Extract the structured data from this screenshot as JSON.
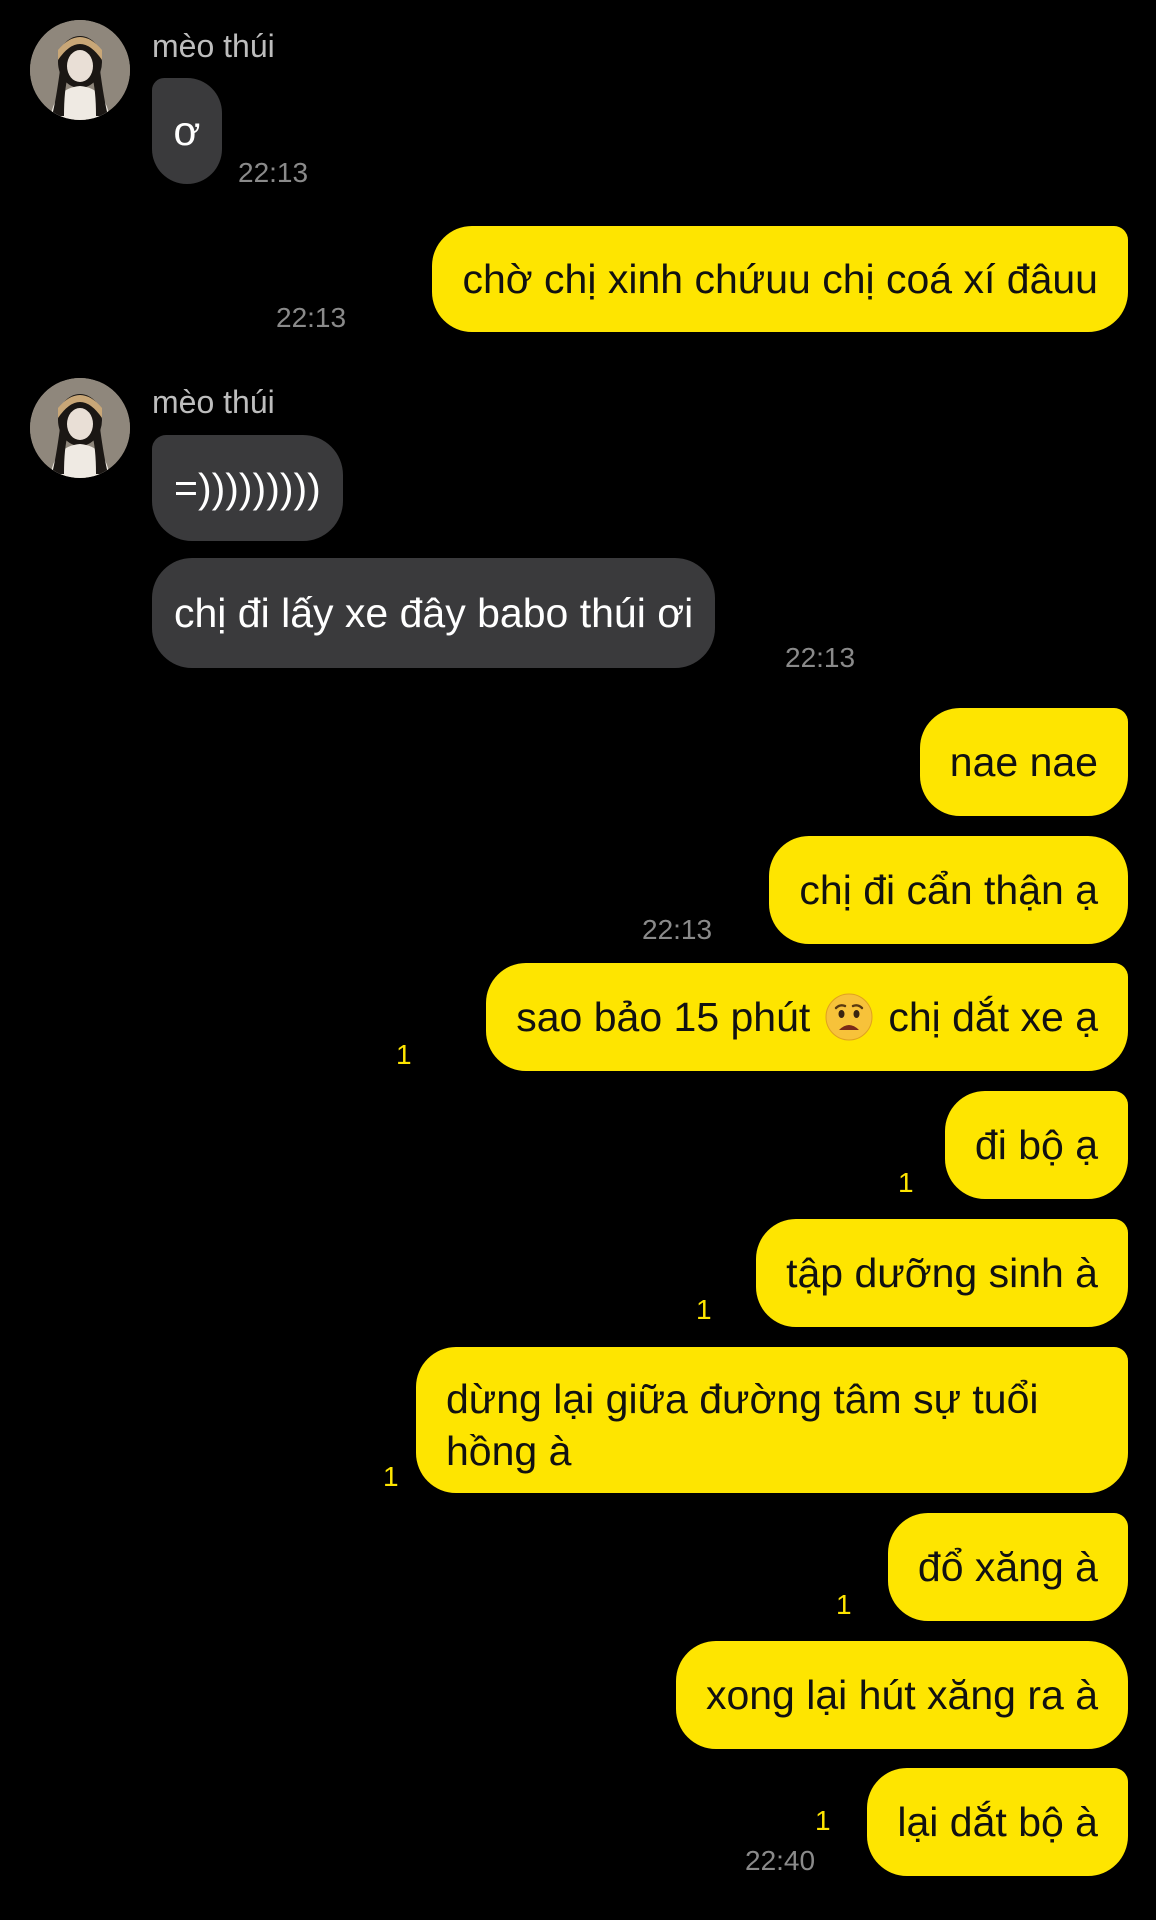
{
  "contact": {
    "name": "mèo thúi"
  },
  "messages": {
    "m1": {
      "text": "ơ",
      "time": "22:13"
    },
    "m2": {
      "text": "chờ chị xinh chứuu chị coá xí đâuu",
      "time": "22:13"
    },
    "m3": {
      "text": "=)))))))))"
    },
    "m4": {
      "text": "chị đi lấy xe đây babo thúi ơi",
      "time": "22:13"
    },
    "m5": {
      "text": "nae nae"
    },
    "m6": {
      "text": "chị đi cẩn thận ạ",
      "time": "22:13"
    },
    "m7": {
      "text_before": "sao bảo 15 phút",
      "emoji": "worried-face-emoji",
      "text_after": "chị dắt xe ạ",
      "unread": "1"
    },
    "m8": {
      "text": "đi bộ ạ",
      "unread": "1"
    },
    "m9": {
      "text": "tập dưỡng sinh à",
      "unread": "1"
    },
    "m10": {
      "text": "dừng lại giữa đường tâm sự tuổi hồng à",
      "unread": "1"
    },
    "m11": {
      "text": "đổ xăng à",
      "unread": "1"
    },
    "m12": {
      "text": "xong lại hút xăng ra à"
    },
    "m13": {
      "text": "lại dắt bộ à",
      "unread": "1",
      "time": "22:40"
    }
  },
  "colors": {
    "background": "#000000",
    "outgoing_bubble": "#fee500",
    "incoming_bubble": "#3a3a3c",
    "unread_count": "#fee500",
    "timestamp": "#8a8a8a"
  }
}
